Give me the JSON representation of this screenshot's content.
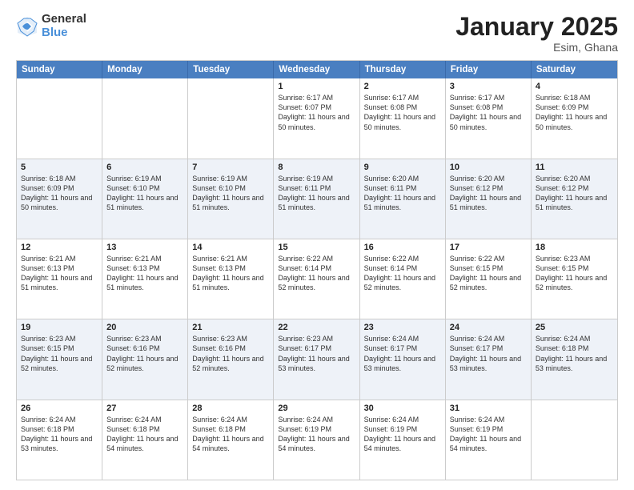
{
  "logo": {
    "general": "General",
    "blue": "Blue"
  },
  "title": "January 2025",
  "location": "Esim, Ghana",
  "header_days": [
    "Sunday",
    "Monday",
    "Tuesday",
    "Wednesday",
    "Thursday",
    "Friday",
    "Saturday"
  ],
  "rows": [
    {
      "alt": false,
      "cells": [
        {
          "day": "",
          "sunrise": "",
          "sunset": "",
          "daylight": ""
        },
        {
          "day": "",
          "sunrise": "",
          "sunset": "",
          "daylight": ""
        },
        {
          "day": "",
          "sunrise": "",
          "sunset": "",
          "daylight": ""
        },
        {
          "day": "1",
          "sunrise": "Sunrise: 6:17 AM",
          "sunset": "Sunset: 6:07 PM",
          "daylight": "Daylight: 11 hours and 50 minutes."
        },
        {
          "day": "2",
          "sunrise": "Sunrise: 6:17 AM",
          "sunset": "Sunset: 6:08 PM",
          "daylight": "Daylight: 11 hours and 50 minutes."
        },
        {
          "day": "3",
          "sunrise": "Sunrise: 6:17 AM",
          "sunset": "Sunset: 6:08 PM",
          "daylight": "Daylight: 11 hours and 50 minutes."
        },
        {
          "day": "4",
          "sunrise": "Sunrise: 6:18 AM",
          "sunset": "Sunset: 6:09 PM",
          "daylight": "Daylight: 11 hours and 50 minutes."
        }
      ]
    },
    {
      "alt": true,
      "cells": [
        {
          "day": "5",
          "sunrise": "Sunrise: 6:18 AM",
          "sunset": "Sunset: 6:09 PM",
          "daylight": "Daylight: 11 hours and 50 minutes."
        },
        {
          "day": "6",
          "sunrise": "Sunrise: 6:19 AM",
          "sunset": "Sunset: 6:10 PM",
          "daylight": "Daylight: 11 hours and 51 minutes."
        },
        {
          "day": "7",
          "sunrise": "Sunrise: 6:19 AM",
          "sunset": "Sunset: 6:10 PM",
          "daylight": "Daylight: 11 hours and 51 minutes."
        },
        {
          "day": "8",
          "sunrise": "Sunrise: 6:19 AM",
          "sunset": "Sunset: 6:11 PM",
          "daylight": "Daylight: 11 hours and 51 minutes."
        },
        {
          "day": "9",
          "sunrise": "Sunrise: 6:20 AM",
          "sunset": "Sunset: 6:11 PM",
          "daylight": "Daylight: 11 hours and 51 minutes."
        },
        {
          "day": "10",
          "sunrise": "Sunrise: 6:20 AM",
          "sunset": "Sunset: 6:12 PM",
          "daylight": "Daylight: 11 hours and 51 minutes."
        },
        {
          "day": "11",
          "sunrise": "Sunrise: 6:20 AM",
          "sunset": "Sunset: 6:12 PM",
          "daylight": "Daylight: 11 hours and 51 minutes."
        }
      ]
    },
    {
      "alt": false,
      "cells": [
        {
          "day": "12",
          "sunrise": "Sunrise: 6:21 AM",
          "sunset": "Sunset: 6:13 PM",
          "daylight": "Daylight: 11 hours and 51 minutes."
        },
        {
          "day": "13",
          "sunrise": "Sunrise: 6:21 AM",
          "sunset": "Sunset: 6:13 PM",
          "daylight": "Daylight: 11 hours and 51 minutes."
        },
        {
          "day": "14",
          "sunrise": "Sunrise: 6:21 AM",
          "sunset": "Sunset: 6:13 PM",
          "daylight": "Daylight: 11 hours and 51 minutes."
        },
        {
          "day": "15",
          "sunrise": "Sunrise: 6:22 AM",
          "sunset": "Sunset: 6:14 PM",
          "daylight": "Daylight: 11 hours and 52 minutes."
        },
        {
          "day": "16",
          "sunrise": "Sunrise: 6:22 AM",
          "sunset": "Sunset: 6:14 PM",
          "daylight": "Daylight: 11 hours and 52 minutes."
        },
        {
          "day": "17",
          "sunrise": "Sunrise: 6:22 AM",
          "sunset": "Sunset: 6:15 PM",
          "daylight": "Daylight: 11 hours and 52 minutes."
        },
        {
          "day": "18",
          "sunrise": "Sunrise: 6:23 AM",
          "sunset": "Sunset: 6:15 PM",
          "daylight": "Daylight: 11 hours and 52 minutes."
        }
      ]
    },
    {
      "alt": true,
      "cells": [
        {
          "day": "19",
          "sunrise": "Sunrise: 6:23 AM",
          "sunset": "Sunset: 6:15 PM",
          "daylight": "Daylight: 11 hours and 52 minutes."
        },
        {
          "day": "20",
          "sunrise": "Sunrise: 6:23 AM",
          "sunset": "Sunset: 6:16 PM",
          "daylight": "Daylight: 11 hours and 52 minutes."
        },
        {
          "day": "21",
          "sunrise": "Sunrise: 6:23 AM",
          "sunset": "Sunset: 6:16 PM",
          "daylight": "Daylight: 11 hours and 52 minutes."
        },
        {
          "day": "22",
          "sunrise": "Sunrise: 6:23 AM",
          "sunset": "Sunset: 6:17 PM",
          "daylight": "Daylight: 11 hours and 53 minutes."
        },
        {
          "day": "23",
          "sunrise": "Sunrise: 6:24 AM",
          "sunset": "Sunset: 6:17 PM",
          "daylight": "Daylight: 11 hours and 53 minutes."
        },
        {
          "day": "24",
          "sunrise": "Sunrise: 6:24 AM",
          "sunset": "Sunset: 6:17 PM",
          "daylight": "Daylight: 11 hours and 53 minutes."
        },
        {
          "day": "25",
          "sunrise": "Sunrise: 6:24 AM",
          "sunset": "Sunset: 6:18 PM",
          "daylight": "Daylight: 11 hours and 53 minutes."
        }
      ]
    },
    {
      "alt": false,
      "cells": [
        {
          "day": "26",
          "sunrise": "Sunrise: 6:24 AM",
          "sunset": "Sunset: 6:18 PM",
          "daylight": "Daylight: 11 hours and 53 minutes."
        },
        {
          "day": "27",
          "sunrise": "Sunrise: 6:24 AM",
          "sunset": "Sunset: 6:18 PM",
          "daylight": "Daylight: 11 hours and 54 minutes."
        },
        {
          "day": "28",
          "sunrise": "Sunrise: 6:24 AM",
          "sunset": "Sunset: 6:18 PM",
          "daylight": "Daylight: 11 hours and 54 minutes."
        },
        {
          "day": "29",
          "sunrise": "Sunrise: 6:24 AM",
          "sunset": "Sunset: 6:19 PM",
          "daylight": "Daylight: 11 hours and 54 minutes."
        },
        {
          "day": "30",
          "sunrise": "Sunrise: 6:24 AM",
          "sunset": "Sunset: 6:19 PM",
          "daylight": "Daylight: 11 hours and 54 minutes."
        },
        {
          "day": "31",
          "sunrise": "Sunrise: 6:24 AM",
          "sunset": "Sunset: 6:19 PM",
          "daylight": "Daylight: 11 hours and 54 minutes."
        },
        {
          "day": "",
          "sunrise": "",
          "sunset": "",
          "daylight": ""
        }
      ]
    }
  ]
}
